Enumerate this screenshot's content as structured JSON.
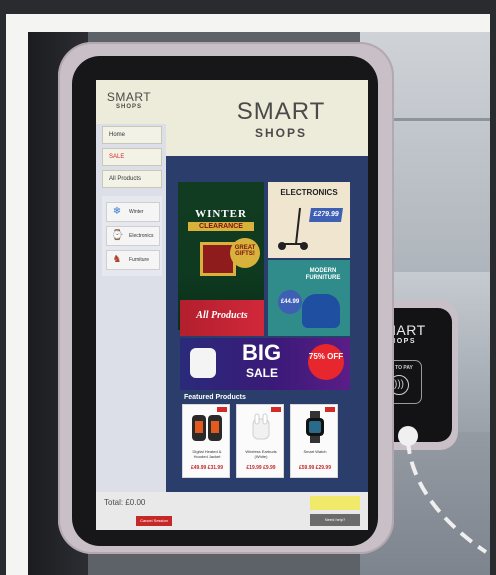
{
  "kiosk": {
    "header": {
      "brand_top": "SMART",
      "brand_bottom": "SHOPS",
      "mini_top": "SMART",
      "mini_bottom": "SHOPS"
    },
    "nav": [
      "Home",
      "SALE",
      "All Products"
    ],
    "categories": [
      "Winter",
      "Electronics",
      "Furniture"
    ],
    "banners": {
      "winter_title": "WINTER",
      "winter_sub": "CLEARANCE",
      "winter_tag": "GREAT GIFTS!",
      "all_products": "All Products",
      "electronics_title": "ELECTRONICS",
      "electronics_price": "£279.99",
      "furniture_title": "MODERN FURNITURE",
      "furniture_price": "£44.99",
      "big_title": "BIG",
      "big_sub": "SALE",
      "big_burst": "75% OFF"
    },
    "featured_title": "Featured Products",
    "products": [
      {
        "name": "Digital Heated & Hooded Jacket",
        "price": "£49.99 £31.99"
      },
      {
        "name": "Wireless Earbuds (White)",
        "price": "£19.99 £9.99"
      },
      {
        "name": "Smart Watch",
        "price": "£59.99 £29.99"
      }
    ],
    "footer": {
      "total": "Total: £0.00",
      "cancel": "Cancel Session",
      "help": "Need help?"
    }
  },
  "card_reader": {
    "brand_top": "SMART",
    "brand_bottom": "SHOPS",
    "tap_label": "TAP TO PAY",
    "tap_icon": "contactless-icon"
  },
  "colors": {
    "screen_bg": "#2b3d6b",
    "header_bg": "#edebd9",
    "accent_red": "#c62828"
  }
}
